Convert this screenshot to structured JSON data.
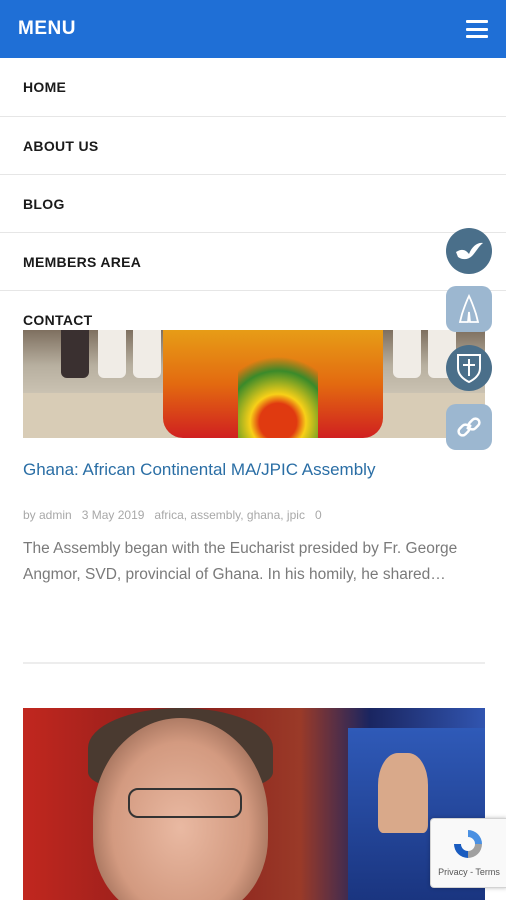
{
  "header": {
    "title": "MENU",
    "menu_icon": "hamburger-icon"
  },
  "menu": {
    "items": [
      {
        "label": "HOME"
      },
      {
        "label": "ABOUT US"
      },
      {
        "label": "BLOG"
      },
      {
        "label": "MEMBERS AREA"
      },
      {
        "label": "CONTACT"
      }
    ]
  },
  "post1": {
    "title": "Ghana: African Continental MA/JPIC Assembly",
    "author": "by admin",
    "date": "3 May 2019",
    "tags": "africa, assembly, ghana, jpic",
    "comments": "0",
    "excerpt": "The Assembly began with the Eucharist presided by Fr. George Angmor, SVD, provincial of Ghana.  In his homily, he shared…"
  },
  "floating_buttons": [
    {
      "icon": "dove-icon"
    },
    {
      "icon": "praying-hands-icon"
    },
    {
      "icon": "crest-icon"
    },
    {
      "icon": "link-icon"
    }
  ],
  "recaptcha": {
    "legal": "Privacy - Terms"
  },
  "colors": {
    "header_bg": "#1f6fd6",
    "title_link": "#2a6ea5",
    "fab_dark": "#4a6f8a",
    "fab_light": "#9cb7d0"
  }
}
